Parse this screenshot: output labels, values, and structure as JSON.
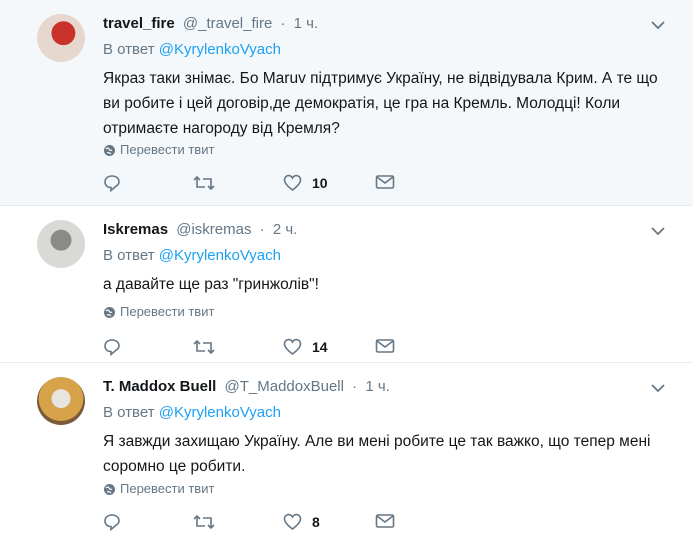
{
  "tweets": [
    {
      "name": "travel_fire",
      "handle": "@_travel_fire",
      "dot": "·",
      "time": "1 ч.",
      "reply_prefix": "В ответ",
      "reply_mention": "@KyrylenkoVyach",
      "text": "Якраз таки знімає. Бо Maruv підтримує Україну, не відвідувала Крим. А те що ви робите і цей договір,де демократія, це гра на Кремль. Молодці! Коли отримаєте нагороду від Кремля?",
      "translate_label": "Перевести твит",
      "likes": "10"
    },
    {
      "name": "Iskremas",
      "handle": "@iskremas",
      "dot": "·",
      "time": "2 ч.",
      "reply_prefix": "В ответ",
      "reply_mention": "@KyrylenkoVyach",
      "text": "а давайте ще раз \"гринжолів\"!",
      "translate_label": "Перевести твит",
      "likes": "14"
    },
    {
      "name": "T. Maddox Buell",
      "handle": "@T_MaddoxBuell",
      "dot": "·",
      "time": "1 ч.",
      "reply_prefix": "В ответ",
      "reply_mention": "@KyrylenkoVyach",
      "text": "Я завжди захищаю Україну. Але ви мені робите це так важко, що тепер мені соромно це робити.",
      "translate_label": "Перевести твит",
      "likes": "8"
    }
  ],
  "colors": {
    "link": "#1da1f2",
    "muted": "#657786",
    "text": "#14171a",
    "highlight_bg": "#f5f8fa",
    "divider": "#e6ecf0"
  },
  "icons": [
    "caret-down-icon",
    "globe-icon",
    "reply-icon",
    "retweet-icon",
    "like-icon",
    "direct-message-icon"
  ]
}
